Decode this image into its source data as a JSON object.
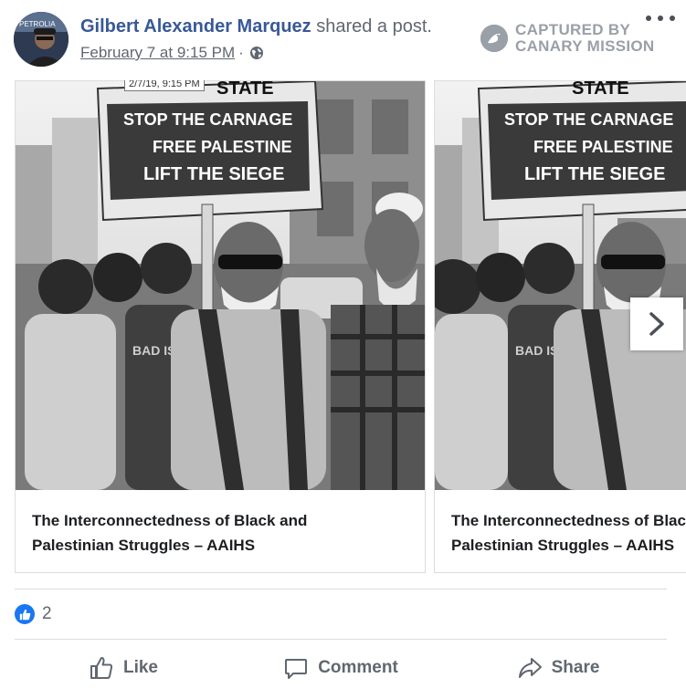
{
  "header": {
    "author_name": "Gilbert Alexander Marquez",
    "shared_text": "shared a post.",
    "timestamp": "February 7 at 9:15 PM",
    "separator": "·",
    "privacy_icon": "globe-icon"
  },
  "watermark": {
    "line1": "CAPTURED BY",
    "line2": "CANARY MISSION"
  },
  "avatar": {
    "badge_text": "PETROLIA"
  },
  "carousel": {
    "date_stamp": "2/7/19, 9:15 PM",
    "cards": [
      {
        "caption_line1": "The Interconnectedness of Black and",
        "caption_line2": "Palestinian Struggles – AAIHS",
        "sign_top": "STATE",
        "sign_line1": "STOP THE CARNAGE",
        "sign_line2": "FREE PALESTINE",
        "sign_line3": "LIFT THE SIEGE",
        "shirt_text": "BAD ISL"
      },
      {
        "caption_line1": "The Interconnectedness of Black and",
        "caption_line2": "Palestinian Struggles – AAIHS",
        "sign_top": "STATE",
        "sign_line1": "STOP THE CARNAGE",
        "sign_line2": "FREE PALESTINE",
        "sign_line3": "LIFT THE SIEGE",
        "shirt_text": "BAD ISL"
      }
    ],
    "next_icon": "chevron-right-icon"
  },
  "reactions": {
    "like_count": "2",
    "icon": "thumbs-up-icon"
  },
  "actions": {
    "like_label": "Like",
    "comment_label": "Comment",
    "share_label": "Share"
  },
  "colors": {
    "author": "#385898",
    "meta": "#606770",
    "divider": "#dadde1",
    "like_blue": "#1877f2",
    "watermark": "#9aa0a8"
  }
}
